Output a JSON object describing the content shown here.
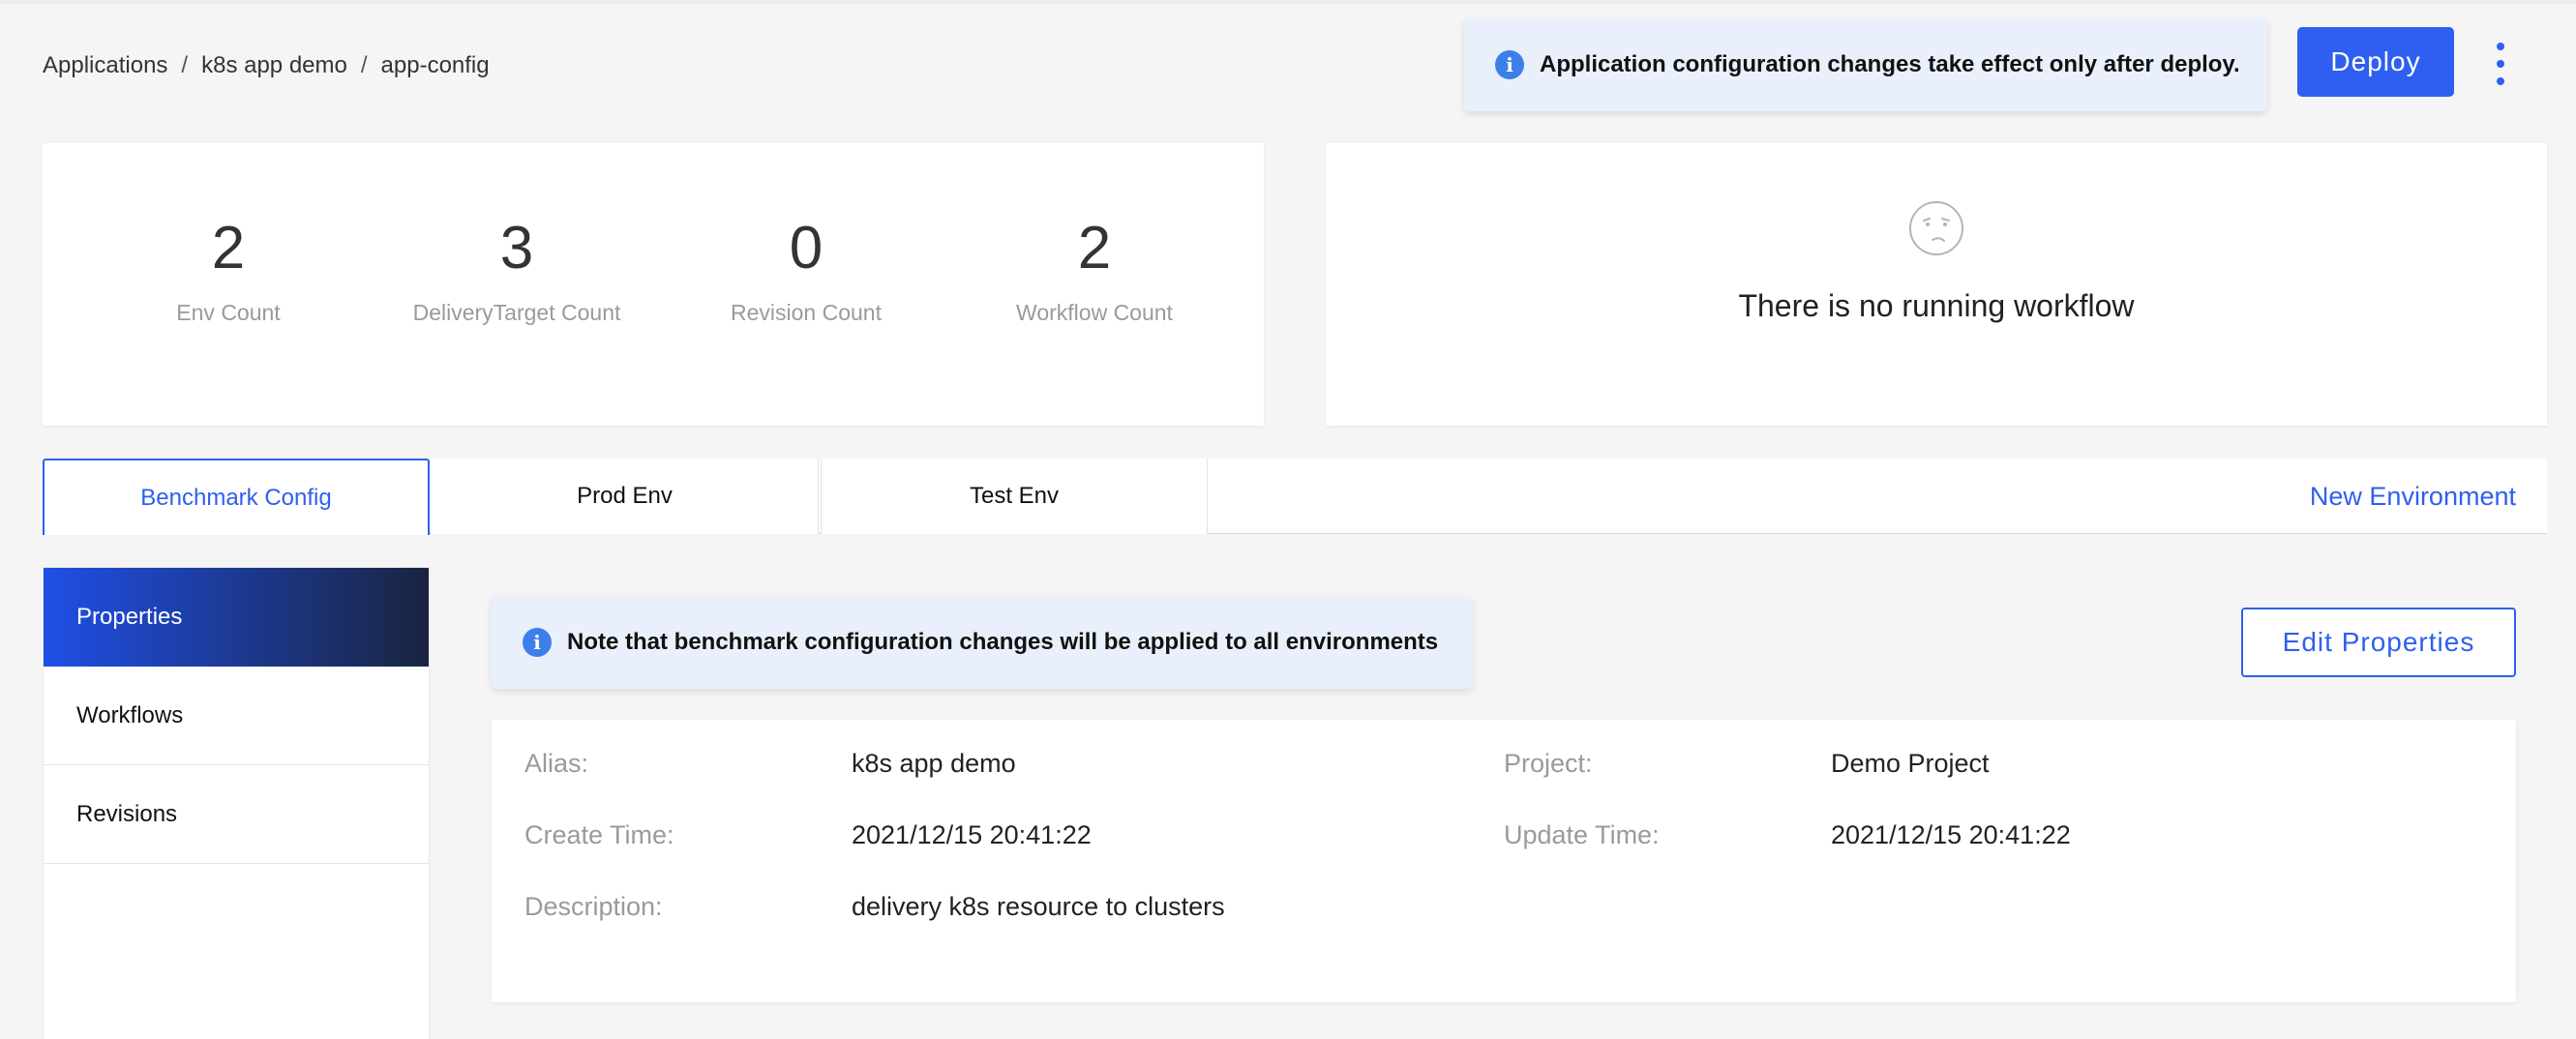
{
  "breadcrumb": {
    "items": [
      "Applications",
      "k8s app demo",
      "app-config"
    ],
    "separator": "/"
  },
  "header": {
    "notice": "Application configuration changes take effect only after deploy.",
    "deploy_label": "Deploy",
    "more_icon": "vertical-dots-icon"
  },
  "stats": [
    {
      "value": "2",
      "label": "Env Count"
    },
    {
      "value": "3",
      "label": "DeliveryTarget Count"
    },
    {
      "value": "0",
      "label": "Revision Count"
    },
    {
      "value": "2",
      "label": "Workflow Count"
    }
  ],
  "workflow": {
    "icon": "confused-face-icon",
    "empty_text": "There is no running workflow"
  },
  "tabs": [
    {
      "label": "Benchmark Config",
      "active": true
    },
    {
      "label": "Prod Env",
      "active": false
    },
    {
      "label": "Test Env",
      "active": false
    }
  ],
  "new_environment_label": "New Environment",
  "side_menu": [
    {
      "label": "Properties",
      "active": true
    },
    {
      "label": "Workflows",
      "active": false
    },
    {
      "label": "Revisions",
      "active": false
    }
  ],
  "note": "Note that benchmark configuration changes will be applied to all environments",
  "edit_properties_label": "Edit Properties",
  "properties": {
    "alias_label": "Alias:",
    "alias": "k8s app demo",
    "project_label": "Project:",
    "project": "Demo Project",
    "create_time_label": "Create Time:",
    "create_time": "2021/12/15 20:41:22",
    "update_time_label": "Update Time:",
    "update_time": "2021/12/15 20:41:22",
    "description_label": "Description:",
    "description": "delivery k8s resource to clusters"
  },
  "colors": {
    "accent": "#2e5ff0",
    "info_bg": "#e9f0fc",
    "info_icon": "#3d7fe9",
    "menu_gradient_start": "#1f4fe6",
    "menu_gradient_end": "#1a2440"
  }
}
